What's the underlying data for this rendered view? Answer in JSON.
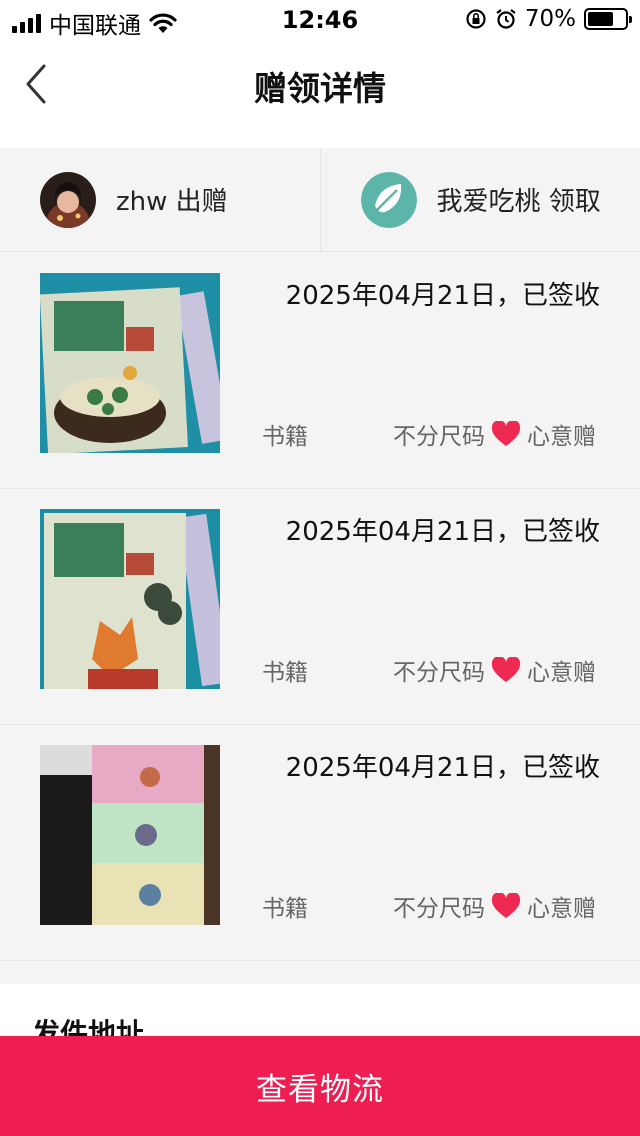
{
  "status_bar": {
    "carrier": "中国联通",
    "time": "12:46",
    "battery": "70%",
    "battery_level": 0.7
  },
  "nav": {
    "title": "赠领详情",
    "back_icon": "chevron-left-icon"
  },
  "parties": {
    "giver": {
      "label": "zhw 出赠"
    },
    "receiver": {
      "label": "我爱吃桃 领取"
    }
  },
  "items": [
    {
      "date_status": "2025年04月21日，已签收",
      "category": "书籍",
      "size": "不分尺码",
      "type": "心意赠"
    },
    {
      "date_status": "2025年04月21日，已签收",
      "category": "书籍",
      "size": "不分尺码",
      "type": "心意赠"
    },
    {
      "date_status": "2025年04月21日，已签收",
      "category": "书籍",
      "size": "不分尺码",
      "type": "心意赠"
    }
  ],
  "address": {
    "title": "发件地址"
  },
  "bottom_button": {
    "label": "查看物流"
  },
  "colors": {
    "accent": "#ee1d52",
    "heart": "#ee2a52",
    "background": "#f4f4f4"
  }
}
